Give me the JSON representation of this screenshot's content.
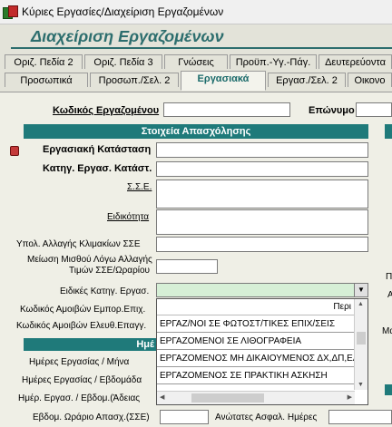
{
  "window": {
    "title": "Κύριες Εργασίες/Διαχείριση Εργαζομένων"
  },
  "header": {
    "title": "Διαχείριση Εργαζομένων"
  },
  "tabs_row1": [
    "Οριζ. Πεδία 2",
    "Οριζ. Πεδία 3",
    "Γνώσεις",
    "Προϋπ.-Υγ.-Πάγ.",
    "Δευτερεύοντα"
  ],
  "tabs_row2": [
    "Προσωπικά",
    "Προσωπ./Σελ. 2",
    "Εργασιακά",
    "Εργασ./Σελ. 2",
    "Οικονο"
  ],
  "form": {
    "emp_code_label": "Κωδικός Εργαζομένου",
    "surname_label": "Επώνυμο",
    "section_title": "Στοιχεία Απασχόλησης",
    "work_status": "Εργασιακή Κατάσταση",
    "category_status": "Κατηγ. Εργασ. Κατάστ.",
    "sse": "Σ.Σ.Ε.",
    "specialty": "Ειδικότητα",
    "calc_change": "Υπολ. Αλλαγής Κλιμακίων ΣΣΕ",
    "reduction_line1": "Μείωση Μισθού Λόγω Αλλαγής",
    "reduction_line2": "Τιμών ΣΣΕ/Ωραρίου",
    "special_category": "Ειδικές Κατηγ. Εργασ.",
    "pay_code_commercial": "Κωδικός Αμοιβών Εμπορ.Επιχ.",
    "pay_code_free": "Κωδικός Αμοιβών Ελευθ.Επαγγ.",
    "section2_partial": "Ημέ",
    "days_month": "Ημέρες Εργασίας / Μήνα",
    "days_week": "Ημέρες Εργασίας / Εβδομάδα",
    "days_leave": "Ημέρ. Εργασ. / Εβδομ.(Άδειας",
    "weekly_hours": "Εβδομ. Ωράριο Απασχ.(ΣΣΕ)",
    "max_insurance": "Ανώτατες Ασφαλ. Ημέρες",
    "right_partial_1": "Π",
    "right_partial_2": "Α",
    "right_partial_3": "Μα"
  },
  "dropdown": {
    "head_text": "Περι",
    "items": [
      "ΕΡΓΑΖ/ΝΟΙ ΣΕ ΦΩΤΟΣΤ/ΤΙΚΕΣ ΕΠΙΧ/ΣΕΙΣ",
      "ΕΡΓΑΖΟΜΕΝΟΙ ΣΕ ΛΙΘΟΓΡΑΦΕΙΑ",
      "ΕΡΓΑΖΟΜΕΝΟΣ ΜΗ ΔΙΚΑΙΟΥΜΕΝΟΣ ΔΧ,ΔΠ,ΕΑ",
      "ΕΡΓΑΖΟΜΕΝΟΣ ΣΕ ΠΡΑΚΤΙΚΗ ΑΣΚΗΣΗ"
    ]
  },
  "colors": {
    "accent": "#1f7a7a",
    "title": "#2d6e6e",
    "panel": "#efefe6",
    "dropdown_bg": "#d6efd6"
  }
}
